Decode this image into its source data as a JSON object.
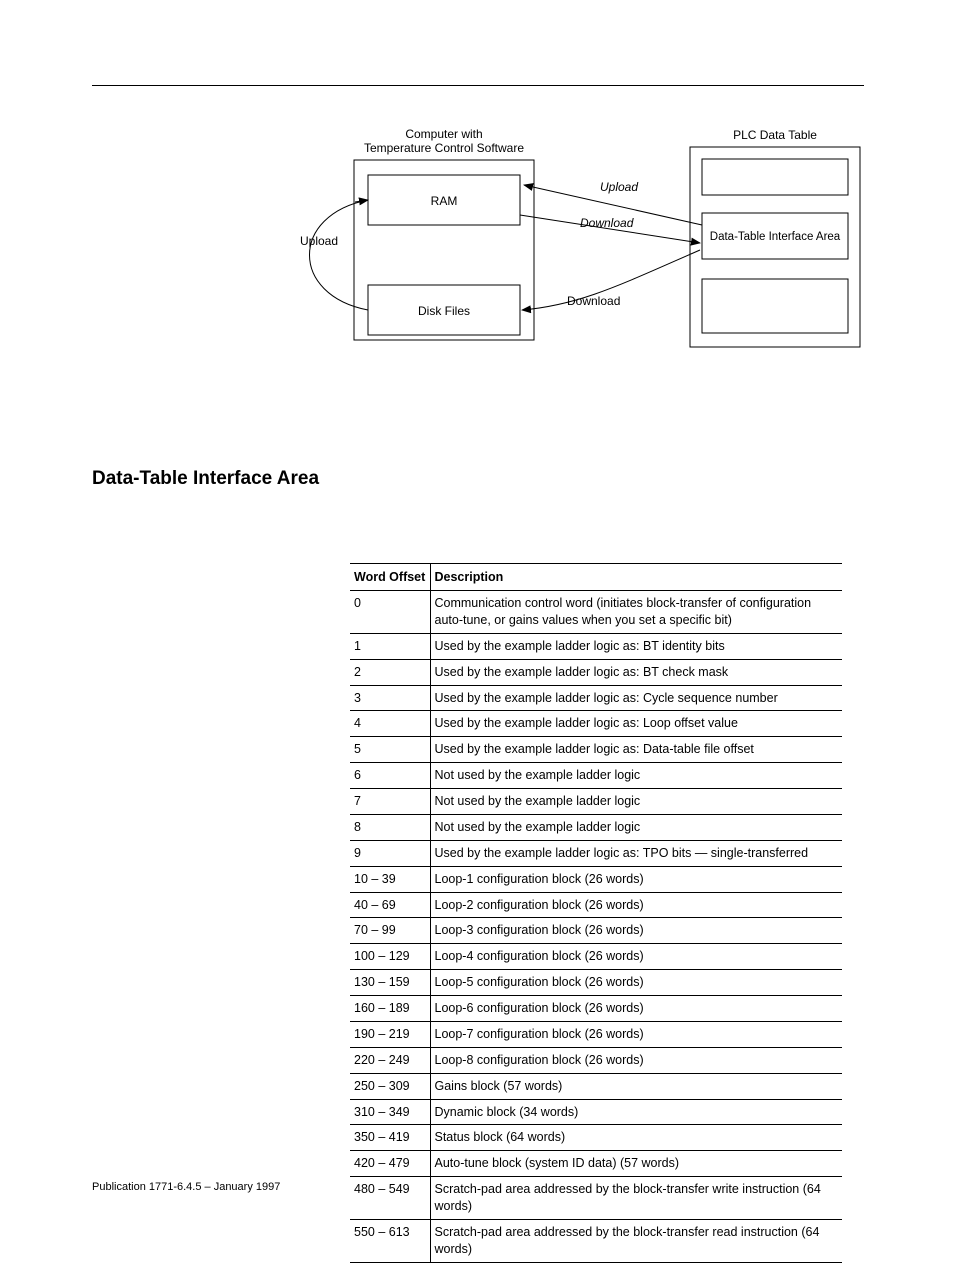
{
  "diagram": {
    "computer_title_l1": "Computer with",
    "computer_title_l2": "Temperature Control Software",
    "ram": "RAM",
    "disk_files": "Disk Files",
    "plc_title": "PLC Data Table",
    "interface_area": "Data-Table Interface Area",
    "upload": "Upload",
    "download": "Download",
    "upload_arrow": "Upload",
    "download_arrow": "Download"
  },
  "section_heading": "Data-Table Interface Area",
  "table": {
    "headers": {
      "col1": "Word Offset",
      "col2": "Description"
    },
    "rows": [
      {
        "offset": "0",
        "desc": "Communication control word (initiates block-transfer of configuration auto-tune, or gains values when you set a specific bit)"
      },
      {
        "offset": "1",
        "desc": "Used by the example ladder logic as: BT identity bits"
      },
      {
        "offset": "2",
        "desc": "Used by the example ladder logic as: BT check mask"
      },
      {
        "offset": "3",
        "desc": "Used by the example ladder logic as: Cycle sequence number"
      },
      {
        "offset": "4",
        "desc": "Used by the example ladder logic as: Loop offset value"
      },
      {
        "offset": "5",
        "desc": "Used by the example ladder logic as: Data-table file offset"
      },
      {
        "offset": "6",
        "desc": "Not used by the example ladder logic"
      },
      {
        "offset": "7",
        "desc": "Not used by the example ladder logic"
      },
      {
        "offset": "8",
        "desc": "Not used by the example ladder logic"
      },
      {
        "offset": "9",
        "desc": "Used by the example ladder logic as: TPO bits  —  single-transferred"
      },
      {
        "offset": "10 – 39",
        "desc": "Loop-1 configuration block (26 words)"
      },
      {
        "offset": "40 – 69",
        "desc": "Loop-2 configuration block (26 words)"
      },
      {
        "offset": "70 – 99",
        "desc": "Loop-3 configuration block (26 words)"
      },
      {
        "offset": "100 – 129",
        "desc": "Loop-4 configuration block (26 words)"
      },
      {
        "offset": "130 – 159",
        "desc": "Loop-5 configuration block (26 words)"
      },
      {
        "offset": "160 – 189",
        "desc": "Loop-6 configuration block (26 words)"
      },
      {
        "offset": "190 – 219",
        "desc": "Loop-7 configuration block (26 words)"
      },
      {
        "offset": "220 – 249",
        "desc": "Loop-8 configuration block (26 words)"
      },
      {
        "offset": "250 – 309",
        "desc": "Gains block (57 words)"
      },
      {
        "offset": "310 – 349",
        "desc": "Dynamic block (34 words)"
      },
      {
        "offset": "350 – 419",
        "desc": "Status block (64 words)"
      },
      {
        "offset": "420 – 479",
        "desc": "Auto-tune block (system ID data) (57 words)"
      },
      {
        "offset": "480 – 549",
        "desc": "Scratch-pad area addressed by the block-transfer write instruction (64 words)"
      },
      {
        "offset": "550 – 613",
        "desc": "Scratch-pad area addressed by the block-transfer read instruction (64 words)"
      }
    ]
  },
  "footer": "Publication 1771-6.4.5 – January 1997"
}
